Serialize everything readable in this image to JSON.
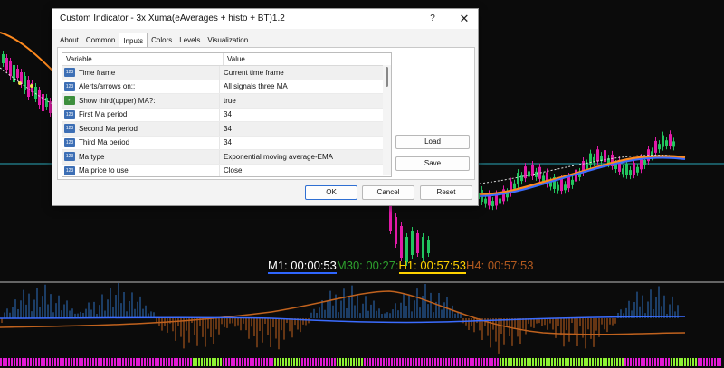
{
  "dialog": {
    "title": "Custom Indicator - 3x Xuma(eAverages + histo + BT)1.2",
    "help_label": "?",
    "close_label": "✕",
    "tabs": [
      "About",
      "Common",
      "Inputs",
      "Colors",
      "Levels",
      "Visualization"
    ],
    "active_tab": "Inputs",
    "table": {
      "headers": [
        "Variable",
        "Value"
      ],
      "rows": [
        {
          "icon": "number-icon",
          "variable": "Time frame",
          "value": "Current time frame"
        },
        {
          "icon": "number-icon",
          "variable": "Alerts/arrows on::",
          "value": "All signals three MA"
        },
        {
          "icon": "bool-icon",
          "variable": "Show third(upper) MA?:",
          "value": "true"
        },
        {
          "icon": "number-icon",
          "variable": "First Ma period",
          "value": "34"
        },
        {
          "icon": "number-icon",
          "variable": "Second Ma period",
          "value": "34"
        },
        {
          "icon": "number-icon",
          "variable": "Third Ma period",
          "value": "34"
        },
        {
          "icon": "number-icon",
          "variable": "Ma type",
          "value": "Exponential moving average-EMA"
        },
        {
          "icon": "number-icon",
          "variable": "Ma price to use",
          "value": "Close"
        }
      ]
    },
    "buttons": {
      "load": "Load",
      "save": "Save",
      "ok": "OK",
      "cancel": "Cancel",
      "reset": "Reset"
    }
  },
  "timers": {
    "m1": "M1: 00:00:53",
    "m30": "M30: 00:27:",
    "h1": "H1: 00:57:53",
    "h4": "H4: 00:57:53"
  },
  "colors": {
    "bull_candle": "#22c55e",
    "bear_candle": "#e11aa8",
    "ma_orange": "#ff8a1f",
    "ma_blue": "#3b6cff",
    "level_cyan": "#2aa7b8",
    "histo_up": "#2c6fbf",
    "histo_down": "#c0621e",
    "bar_magenta": "#e21bd4",
    "bar_lime": "#8ef233"
  }
}
